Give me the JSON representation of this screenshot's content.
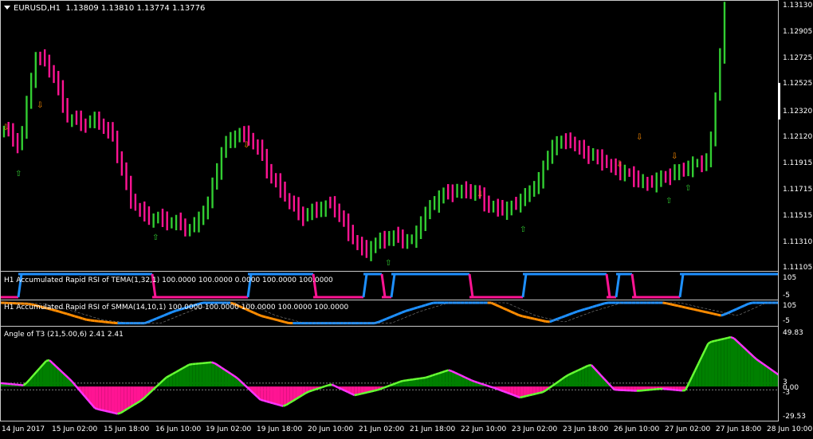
{
  "main": {
    "symbol": "EURUSD,H1",
    "ohlc": "1.13809 1.13810 1.13774 1.13776",
    "price_ticks": [
      "1.13130",
      "1.12905",
      "1.12725",
      "1.12525",
      "1.12320",
      "1.12120",
      "1.11915",
      "1.11715",
      "1.11515",
      "1.11310",
      "1.11105"
    ]
  },
  "ind1": {
    "title": "H1 Accumulated Rapid RSI of TEMA(1,32,1) 100.0000 100.0000 0.0000 100.0000 100.0000",
    "ticks": [
      "105",
      "-5"
    ]
  },
  "ind2": {
    "title": "H1 Accumulated Rapid RSI of SMMA(14,10,1) 100.0000 100.0000 100.0000 100.0000 100.0000",
    "ticks": [
      "105",
      "-5"
    ]
  },
  "ind3": {
    "title": "Angle of T3 (21,5.00,6) 2.41 2.41",
    "ticks": [
      "49.83",
      "3",
      "0.00",
      "-3",
      "-29.53"
    ]
  },
  "time_axis": [
    "14 Jun 2017",
    "15 Jun 02:00",
    "15 Jun 18:00",
    "16 Jun 10:00",
    "19 Jun 02:00",
    "19 Jun 18:00",
    "20 Jun 10:00",
    "21 Jun 02:00",
    "21 Jun 18:00",
    "22 Jun 10:00",
    "23 Jun 02:00",
    "23 Jun 18:00",
    "26 Jun 10:00",
    "27 Jun 02:00",
    "27 Jun 18:00",
    "28 Jun 10:00"
  ],
  "colors": {
    "bull": "#32cd32",
    "bear": "#ff1493",
    "rsi_up": "#1e90ff",
    "rsi_down": "#ff1493",
    "smma_down": "#ff8c00",
    "t3_pos": "#008000",
    "t3_neg": "#ff1493"
  },
  "chart_data": [
    {
      "type": "candlestick",
      "title": "EURUSD,H1",
      "ylim": [
        1.11105,
        1.1313
      ],
      "y_ticks": [
        1.1313,
        1.12905,
        1.12725,
        1.12525,
        1.1232,
        1.1212,
        1.11915,
        1.11715,
        1.11515,
        1.1131,
        1.11105
      ],
      "close_path_approx": [
        1.1218,
        1.1205,
        1.1275,
        1.1265,
        1.1228,
        1.1222,
        1.1225,
        1.121,
        1.1165,
        1.115,
        1.1148,
        1.1145,
        1.114,
        1.116,
        1.1205,
        1.1215,
        1.1208,
        1.1182,
        1.1165,
        1.115,
        1.1156,
        1.116,
        1.1138,
        1.1122,
        1.1132,
        1.1135,
        1.113,
        1.1155,
        1.1168,
        1.117,
        1.117,
        1.1158,
        1.1155,
        1.1163,
        1.1175,
        1.1205,
        1.121,
        1.12,
        1.1195,
        1.1187,
        1.1182,
        1.1175,
        1.118,
        1.1185,
        1.119,
        1.1194,
        1.131
      ]
    },
    {
      "type": "line",
      "title": "H1 Accumulated Rapid RSI of TEMA(1,32,1)",
      "ylim": [
        -5,
        105
      ],
      "values_approx": [
        0,
        100,
        0,
        100,
        0,
        100,
        100,
        0,
        0,
        100,
        0,
        100,
        0,
        100,
        100,
        100
      ]
    },
    {
      "type": "line",
      "title": "H1 Accumulated Rapid RSI of SMMA(14,10,1)",
      "ylim": [
        -5,
        105
      ],
      "values_approx": [
        100,
        95,
        60,
        20,
        5,
        5,
        60,
        100,
        100,
        40,
        5,
        5,
        5,
        5,
        60,
        100,
        100,
        100,
        40,
        10,
        60,
        100,
        100,
        100,
        70,
        40,
        100,
        100
      ]
    },
    {
      "type": "area",
      "title": "Angle of T3 (21,5.00,6)",
      "ylim": [
        -29.53,
        49.83
      ],
      "levels": [
        3,
        0,
        -3
      ],
      "values_approx": [
        3,
        1,
        25,
        5,
        -20,
        -25,
        -12,
        8,
        20,
        22,
        8,
        -12,
        -18,
        -5,
        2,
        -8,
        -3,
        5,
        8,
        15,
        5,
        -2,
        -10,
        -5,
        10,
        20,
        -3,
        -4,
        -2,
        -4,
        40,
        45,
        25,
        10
      ]
    }
  ]
}
